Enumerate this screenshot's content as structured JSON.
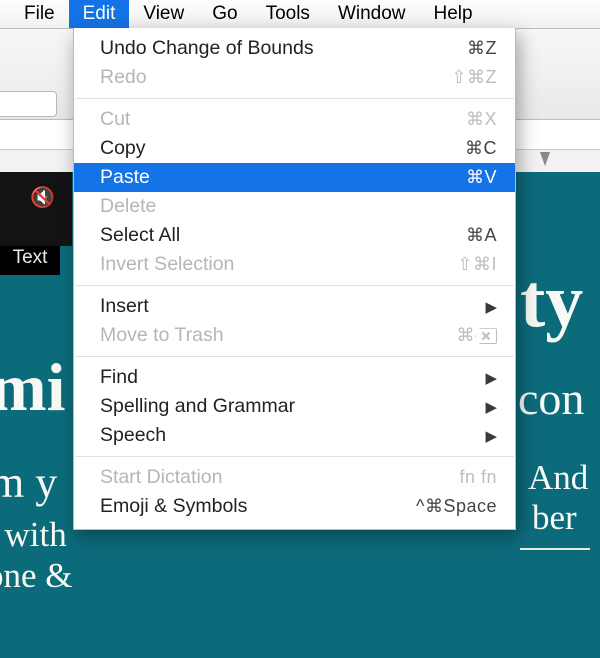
{
  "menubar": {
    "items": [
      "File",
      "Edit",
      "View",
      "Go",
      "Tools",
      "Window",
      "Help"
    ],
    "open_index": 1
  },
  "toolbar": {
    "text_button": "Text"
  },
  "edit_menu": {
    "highlight_index": 5,
    "rows": [
      {
        "label": "Undo Change of Bounds",
        "kbd": "⌘Z",
        "disabled": false
      },
      {
        "label": "Redo",
        "kbd": "⇧⌘Z",
        "disabled": true
      },
      {
        "sep": true
      },
      {
        "label": "Cut",
        "kbd": "⌘X",
        "disabled": true
      },
      {
        "label": "Copy",
        "kbd": "⌘C",
        "disabled": false
      },
      {
        "label": "Paste",
        "kbd": "⌘V",
        "disabled": false
      },
      {
        "label": "Delete",
        "kbd": "",
        "disabled": true
      },
      {
        "label": "Select All",
        "kbd": "⌘A",
        "disabled": false
      },
      {
        "label": "Invert Selection",
        "kbd": "⇧⌘I",
        "disabled": true
      },
      {
        "sep": true
      },
      {
        "label": "Insert",
        "submenu": true,
        "disabled": false
      },
      {
        "label": "Move to Trash",
        "kbd": "⌘",
        "delicon": true,
        "disabled": true
      },
      {
        "sep": true
      },
      {
        "label": "Find",
        "submenu": true,
        "disabled": false
      },
      {
        "label": "Spelling and Grammar",
        "submenu": true,
        "disabled": false
      },
      {
        "label": "Speech",
        "submenu": true,
        "disabled": false
      },
      {
        "sep": true
      },
      {
        "label": "Start Dictation",
        "kbd": "fn fn",
        "disabled": true
      },
      {
        "label": "Emoji & Symbols",
        "kbd": "^⌘Space",
        "disabled": false
      }
    ]
  },
  "background": {
    "frag1": "ty",
    "frag2": "mi",
    "frag3": "con",
    "frag4": "m y",
    "frag5": "And",
    "frag6": "l with",
    "frag7": "ber",
    "frag8": "one &"
  }
}
